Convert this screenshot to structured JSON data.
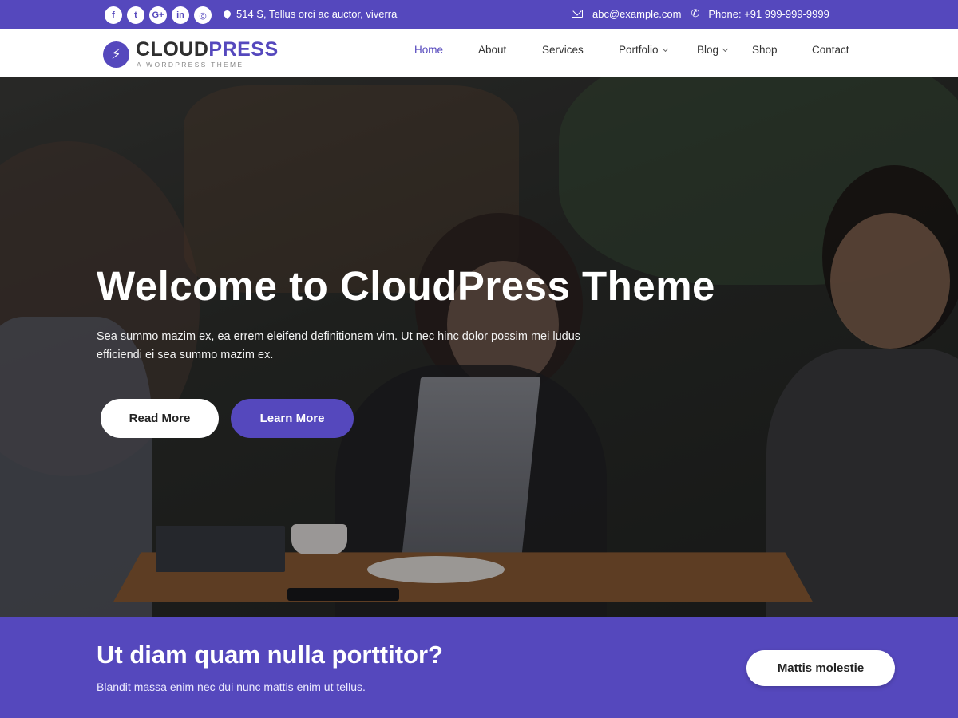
{
  "topbar": {
    "social": [
      {
        "icon": "facebook-icon",
        "glyph": "f"
      },
      {
        "icon": "twitter-icon",
        "glyph": "t"
      },
      {
        "icon": "google-plus-icon",
        "glyph": "G+"
      },
      {
        "icon": "linkedin-icon",
        "glyph": "in"
      },
      {
        "icon": "instagram-icon",
        "glyph": "◎"
      }
    ],
    "address": "514 S, Tellus orci ac auctor, viverra",
    "email": "abc@example.com",
    "phone": "Phone: +91 999-999-9999"
  },
  "header": {
    "logo_part1": "CLOUD",
    "logo_part2": "PRESS",
    "logo_tagline": "A WORDPRESS THEME",
    "nav": [
      {
        "label": "Home",
        "active": true,
        "dropdown": false
      },
      {
        "label": "About",
        "active": false,
        "dropdown": false
      },
      {
        "label": "Services",
        "active": false,
        "dropdown": false
      },
      {
        "label": "Portfolio",
        "active": false,
        "dropdown": true
      },
      {
        "label": "Blog",
        "active": false,
        "dropdown": true
      },
      {
        "label": "Shop",
        "active": false,
        "dropdown": false
      },
      {
        "label": "Contact",
        "active": false,
        "dropdown": false
      }
    ]
  },
  "hero": {
    "title": "Welcome to CloudPress Theme",
    "subtitle": "Sea summo mazim ex, ea errem eleifend definitionem vim. Ut nec hinc dolor possim mei ludus efficiendi ei sea summo mazim ex.",
    "read_more": "Read More",
    "learn_more": "Learn More"
  },
  "cta": {
    "heading": "Ut diam quam nulla porttitor?",
    "text": "Blandit massa enim nec dui nunc mattis enim ut tellus.",
    "button": "Mattis molestie"
  },
  "colors": {
    "brand": "#5548bd",
    "text_dark": "#333333"
  }
}
